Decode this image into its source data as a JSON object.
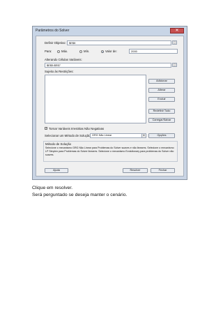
{
  "dialog": {
    "title": "Parâmetros do Solver",
    "close_glyph": "✕",
    "objective": {
      "label": "Definir Objetivo:",
      "value": "$E$8"
    },
    "to": {
      "label": "Para:",
      "options": [
        {
          "label": "Máx.",
          "selected": false
        },
        {
          "label": "Mín.",
          "selected": false
        },
        {
          "label": "Valor de:",
          "selected": true
        }
      ],
      "value_of": "2000"
    },
    "changing_cells": {
      "label": "Alterando Células Variáveis:",
      "value": "$E$5:$E$7"
    },
    "constraints_label": "Sujeito às Restrições:",
    "constraint_buttons": [
      "Adicionar",
      "Alterar",
      "Excluir",
      "Redefinir Tudo",
      "Carregar/Salvar"
    ],
    "nonnegative": {
      "label": "Tornar Variáveis Irrestritas Não Negativas",
      "checked": true
    },
    "method": {
      "label": "Selecionar um Método de Solução:",
      "value": "GRG Não Linear",
      "options_button": "Opções"
    },
    "solving_method": {
      "title": "Método de Solução",
      "description": "Selecione o mecanismo GRG Não Linear para Problemas do Solver suaves e não lineares. Selecione o mecanismo LP Simplex para Problemas do Solver lineares. Selecione o mecanismo Evolutionary para problemas do Solver não suaves."
    },
    "footer": {
      "help": "Ajuda",
      "solve": "Resolver",
      "close": "Fechar"
    },
    "ref_glyph": "⬚"
  },
  "text": {
    "line1": "Clique em resolver.",
    "line2": "Será perguntado se deseja manter o cenário."
  }
}
